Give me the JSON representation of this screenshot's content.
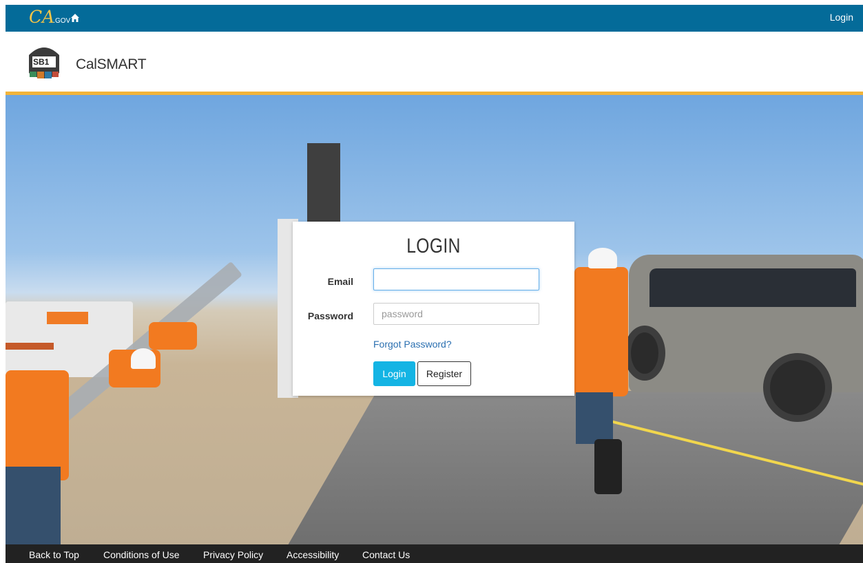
{
  "topbar": {
    "logo_text": "CA",
    "logo_suffix": ".GOV",
    "login_label": "Login"
  },
  "header": {
    "logo_text": "SB1",
    "app_name": "CalSMART"
  },
  "login_card": {
    "title": "LOGIN",
    "email_label": "Email",
    "email_value": "",
    "password_label": "Password",
    "password_placeholder": "password",
    "forgot_label": "Forgot Password?",
    "login_button": "Login",
    "register_button": "Register"
  },
  "footer": {
    "links": [
      "Back to Top",
      "Conditions of Use",
      "Privacy Policy",
      "Accessibility",
      "Contact Us"
    ]
  },
  "colors": {
    "gov_blue": "#046b99",
    "gold": "#f2b43a",
    "accent": "#14b4e4",
    "footer": "#222222"
  },
  "icons": [
    "home-icon",
    "sb1-shield-icon"
  ]
}
